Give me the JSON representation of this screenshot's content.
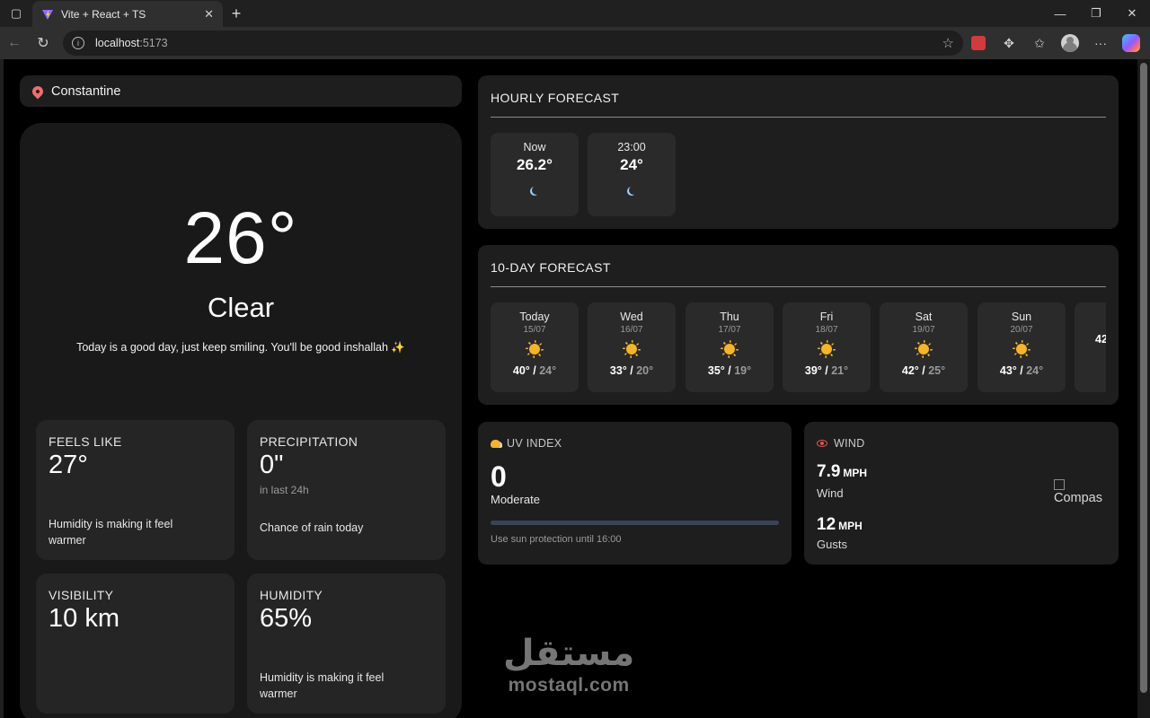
{
  "browser": {
    "tab_title": "Vite + React + TS",
    "url_host": "localhost",
    "url_port": ":5173",
    "icons": [
      "tab-actions-icon",
      "vite-favicon",
      "close-icon",
      "plus-icon",
      "minimize-icon",
      "restore-icon",
      "window-close-icon",
      "back-icon",
      "refresh-icon",
      "info-icon",
      "star-icon",
      "extension-icon",
      "puzzle-icon",
      "favorites-icon",
      "profile-icon",
      "more-icon",
      "copilot-icon"
    ]
  },
  "location": {
    "name": "Constantine",
    "icon": "map-pin-icon"
  },
  "current": {
    "temperature": "26°",
    "condition": "Clear",
    "message": "Today is a good day, just keep smiling. You'll be good inshallah ✨"
  },
  "stats": {
    "feels_like": {
      "label": "FEELS LIKE",
      "value": "27°",
      "note": "Humidity is making it feel warmer"
    },
    "precipitation": {
      "label": "PRECIPITATION",
      "value": "0\"",
      "sub": "in last 24h",
      "note": "Chance of rain today"
    },
    "visibility": {
      "label": "VISIBILITY",
      "value": "10 km"
    },
    "humidity": {
      "label": "HUMIDITY",
      "value": "65%",
      "note": "Humidity is making it feel warmer"
    }
  },
  "hourly": {
    "title": "HOURLY FORECAST",
    "items": [
      {
        "time": "Now",
        "temp": "26.2°",
        "icon": "moon-icon"
      },
      {
        "time": "23:00",
        "temp": "24°",
        "icon": "moon-icon"
      }
    ]
  },
  "tenday": {
    "title": "10-DAY FORECAST",
    "days": [
      {
        "day": "Today",
        "date": "15/07",
        "high": "40°",
        "low": "24°",
        "icon": "sun-icon"
      },
      {
        "day": "Wed",
        "date": "16/07",
        "high": "33°",
        "low": "20°",
        "icon": "sun-icon"
      },
      {
        "day": "Thu",
        "date": "17/07",
        "high": "35°",
        "low": "19°",
        "icon": "sun-icon"
      },
      {
        "day": "Fri",
        "date": "18/07",
        "high": "39°",
        "low": "21°",
        "icon": "sun-icon"
      },
      {
        "day": "Sat",
        "date": "19/07",
        "high": "42°",
        "low": "25°",
        "icon": "sun-icon"
      },
      {
        "day": "Sun",
        "date": "20/07",
        "high": "43°",
        "low": "24°",
        "icon": "sun-icon"
      },
      {
        "day": "",
        "date": "",
        "high": "42",
        "low": "",
        "icon": "sun-icon"
      }
    ]
  },
  "uv": {
    "title": "UV INDEX",
    "value": "0",
    "level": "Moderate",
    "progress": 0,
    "note": "Use sun protection until 16:00",
    "icon": "sun-cloud-icon"
  },
  "wind": {
    "title": "WIND",
    "speed": "7.9",
    "speed_unit": "MPH",
    "speed_label": "Wind",
    "gusts": "12",
    "gusts_unit": "MPH",
    "gusts_label": "Gusts",
    "compass_alt": "Compas",
    "icon": "eye-icon"
  },
  "watermark": {
    "arabic": "مستقل",
    "latin": "mostaql.com"
  },
  "colors": {
    "page_bg": "#000000",
    "card_bg": "#1e1e1e",
    "tile_bg": "#2a2a2a",
    "sun": "#f5b42a",
    "pin": "#f06d6d",
    "moon": "#9ad1ff"
  }
}
